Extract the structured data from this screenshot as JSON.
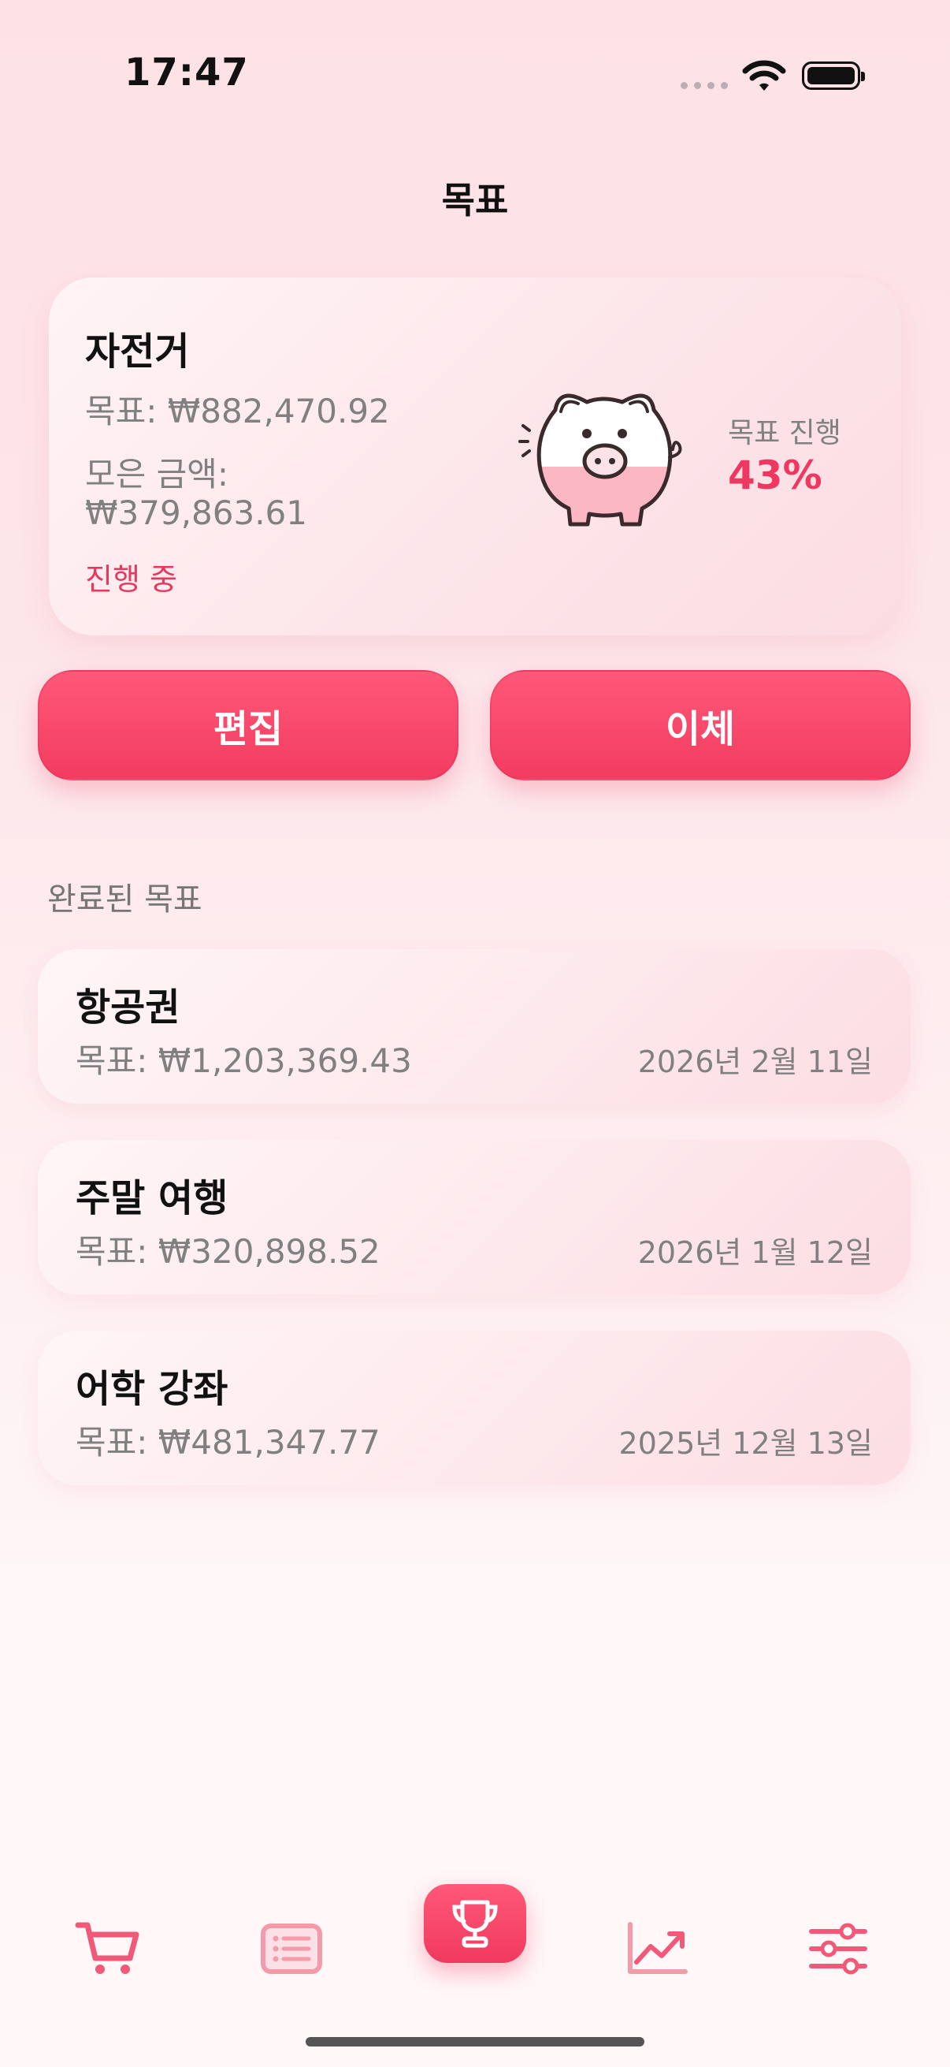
{
  "status_bar": {
    "time": "17:47"
  },
  "header": {
    "title": "목표"
  },
  "active_goal": {
    "name": "자전거",
    "target": "목표: ₩882,470.92",
    "saved_label": "모은 금액:",
    "saved_value": "₩379,863.61",
    "status": "진행 중",
    "progress_label": "목표 진행",
    "progress_value": "43%",
    "progress_fraction": 0.43
  },
  "actions": {
    "edit_label": "편집",
    "transfer_label": "이체"
  },
  "completed": {
    "section_title": "완료된 목표",
    "items": [
      {
        "name": "항공권",
        "target": "목표: ₩1,203,369.43",
        "date": "2026년 2월 11일"
      },
      {
        "name": "주말 여행",
        "target": "목표: ₩320,898.52",
        "date": "2026년 1월 12일"
      },
      {
        "name": "어학 강좌",
        "target": "목표: ₩481,347.77",
        "date": "2025년 12월 13일"
      }
    ]
  },
  "tabs": [
    {
      "icon": "cart-icon",
      "active": false
    },
    {
      "icon": "list-icon",
      "active": false
    },
    {
      "icon": "trophy-icon",
      "active": true
    },
    {
      "icon": "chart-icon",
      "active": false
    },
    {
      "icon": "sliders-icon",
      "active": false
    }
  ],
  "colors": {
    "accent": "#f23c60",
    "muted_text": "#808080",
    "background": "#fde6ea"
  }
}
